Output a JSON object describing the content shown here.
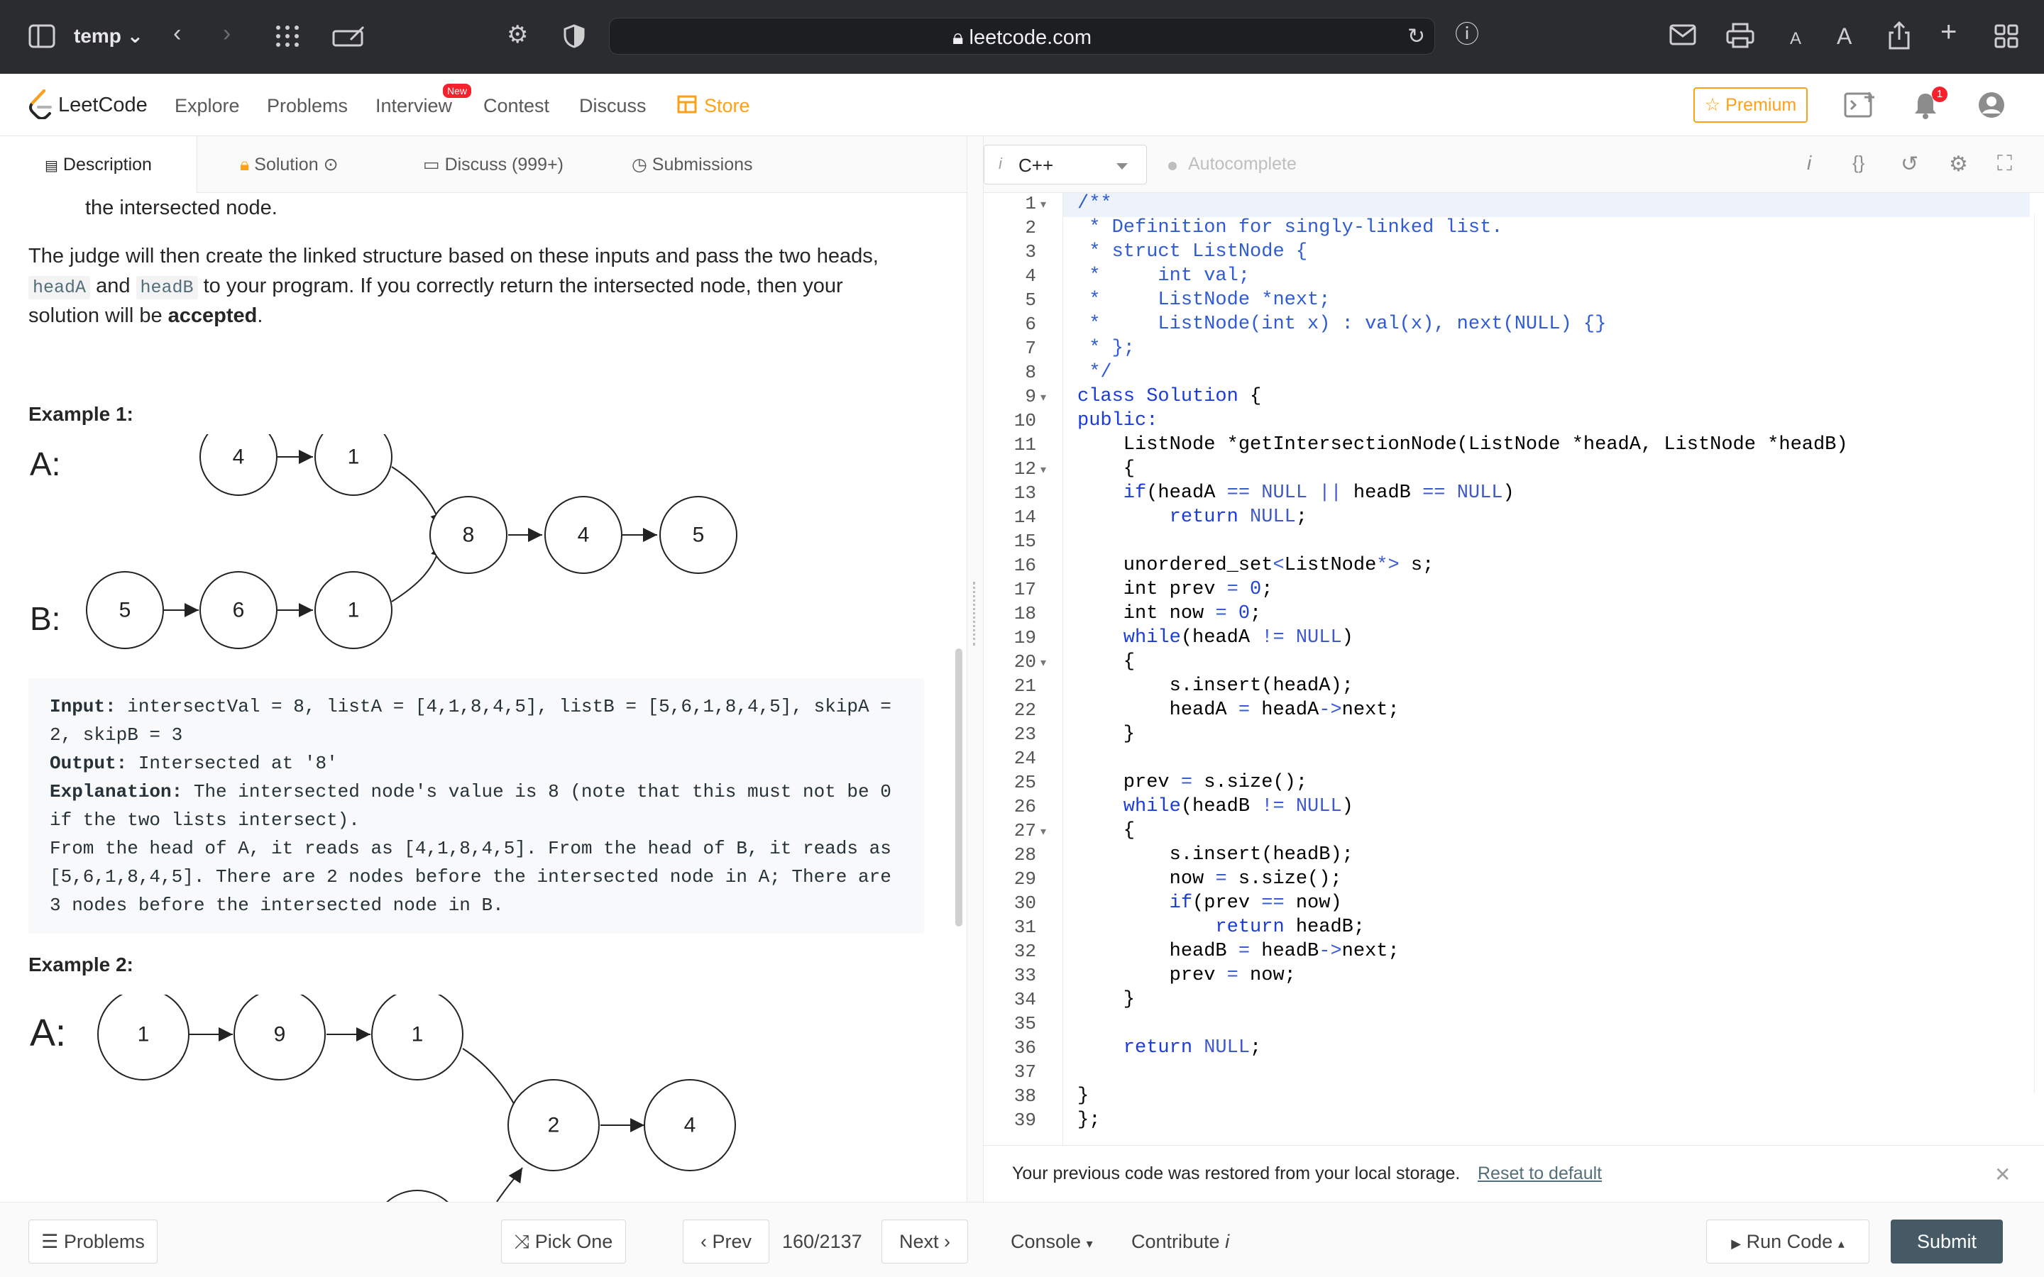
{
  "browser": {
    "tab_group": "temp",
    "url": "leetcode.com"
  },
  "nav": {
    "logo": "LeetCode",
    "items": [
      "Explore",
      "Problems",
      "Interview",
      "Contest",
      "Discuss",
      "Store"
    ],
    "new_badge": "New",
    "premium": "Premium",
    "notifications": "1"
  },
  "tabs": {
    "description": "Description",
    "solution": "Solution",
    "discuss": "Discuss (999+)",
    "submissions": "Submissions"
  },
  "description": {
    "line_top": "the intersected node.",
    "judge_1": "The judge will then create the linked structure based on these inputs and pass the two heads,",
    "judge_code_a": "headA",
    "judge_and": "and",
    "judge_code_b": "headB",
    "judge_2": "to your program. If you correctly return the intersected node, then your",
    "judge_3": "solution will be",
    "judge_accepted": "accepted",
    "judge_period": ".",
    "example1_title": "Example 1:",
    "example2_title": "Example 2:",
    "example1": {
      "input_label": "Input:",
      "input_1": " intersectVal = 8, listA = [4,1,8,4,5], listB = [5,6,1,8,4,5], skipA =",
      "input_2": "2, skipB = 3",
      "output_label": "Output:",
      "output": " Intersected at '8'",
      "explanation_label": "Explanation:",
      "explanation_1": " The intersected node's value is 8 (note that this must not be 0",
      "explanation_2": "if the two lists intersect).",
      "explanation_3": "From the head of A, it reads as [4,1,8,4,5]. From the head of B, it reads as",
      "explanation_4": "[5,6,1,8,4,5]. There are 2 nodes before the intersected node in A; There are",
      "explanation_5": "3 nodes before the intersected node in B."
    },
    "diagram1": {
      "label_a": "A:",
      "label_b": "B:",
      "nodes_a": [
        "4",
        "1"
      ],
      "nodes_shared": [
        "8",
        "4",
        "5"
      ],
      "nodes_b": [
        "5",
        "6",
        "1"
      ]
    },
    "diagram2": {
      "label_a": "A:",
      "nodes_a": [
        "1",
        "9",
        "1"
      ],
      "nodes_shared": [
        "2",
        "4"
      ]
    }
  },
  "editor": {
    "language": "C++",
    "autocomplete": "Autocomplete",
    "line_numbers": [
      "1",
      "2",
      "3",
      "4",
      "5",
      "6",
      "7",
      "8",
      "9",
      "10",
      "11",
      "12",
      "13",
      "14",
      "15",
      "16",
      "17",
      "18",
      "19",
      "20",
      "21",
      "22",
      "23",
      "24",
      "25",
      "26",
      "27",
      "28",
      "29",
      "30",
      "31",
      "32",
      "33",
      "34",
      "35",
      "36",
      "37",
      "38",
      "39"
    ],
    "code": {
      "l1": "/**",
      "l2": " * Definition for singly-linked list.",
      "l3": " * struct ListNode {",
      "l4": " *     int val;",
      "l5": " *     ListNode *next;",
      "l6": " *     ListNode(int x) : val(x), next(NULL) {}",
      "l7": " * };",
      "l8": " */",
      "l9a": "class Solution",
      "l9b": " {",
      "l10": "public:",
      "l11": "    ListNode *getIntersectionNode(ListNode *headA, ListNode *headB)",
      "l12": "    {",
      "l13a": "    if",
      "l13b": "(headA ",
      "l13c": "==",
      "l13d": " NULL",
      "l13e": " || ",
      "l13f": "headB ",
      "l13g": "==",
      "l13h": " NULL",
      "l13i": ")",
      "l14a": "        return",
      "l14b": " NULL",
      "l14c": ";",
      "l16a": "    unordered_set",
      "l16b": "<",
      "l16c": "ListNode",
      "l16d": "*>",
      "l16e": " s;",
      "l17a": "    int prev ",
      "l17b": "=",
      "l17c": " 0",
      "l17d": ";",
      "l18a": "    int now ",
      "l18b": "=",
      "l18c": " 0",
      "l18d": ";",
      "l19a": "    while",
      "l19b": "(headA ",
      "l19c": "!=",
      "l19d": " NULL",
      "l19e": ")",
      "l20": "    {",
      "l21": "        s.insert(headA);",
      "l22a": "        headA ",
      "l22b": "=",
      "l22c": " headA",
      "l22d": "->",
      "l22e": "next;",
      "l23": "    }",
      "l25a": "    prev ",
      "l25b": "=",
      "l25c": " s.size();",
      "l26a": "    while",
      "l26b": "(headB ",
      "l26c": "!=",
      "l26d": " NULL",
      "l26e": ")",
      "l27": "    {",
      "l28": "        s.insert(headB);",
      "l29a": "        now ",
      "l29b": "=",
      "l29c": " s.size();",
      "l30a": "        if",
      "l30b": "(prev ",
      "l30c": "==",
      "l30d": " now)",
      "l31a": "            return",
      "l31b": " headB;",
      "l32a": "        headB ",
      "l32b": "=",
      "l32c": " headB",
      "l32d": "->",
      "l32e": "next;",
      "l33a": "        prev ",
      "l33b": "=",
      "l33c": " now;",
      "l34": "    }",
      "l36a": "    return",
      "l36b": " NULL",
      "l36c": ";",
      "l38": "}",
      "l39": "};"
    }
  },
  "notice": {
    "text": "Your previous code was restored from your local storage.",
    "reset": "Reset to default"
  },
  "bottom": {
    "problems": "Problems",
    "pick_one": "Pick One",
    "prev": "Prev",
    "counter": "160/2137",
    "next": "Next",
    "console": "Console",
    "contribute": "Contribute",
    "run_code": "Run Code",
    "submit": "Submit"
  },
  "colors": {
    "accent": "#ffa116",
    "submit": "#455a64",
    "badge": "#f5222d"
  }
}
